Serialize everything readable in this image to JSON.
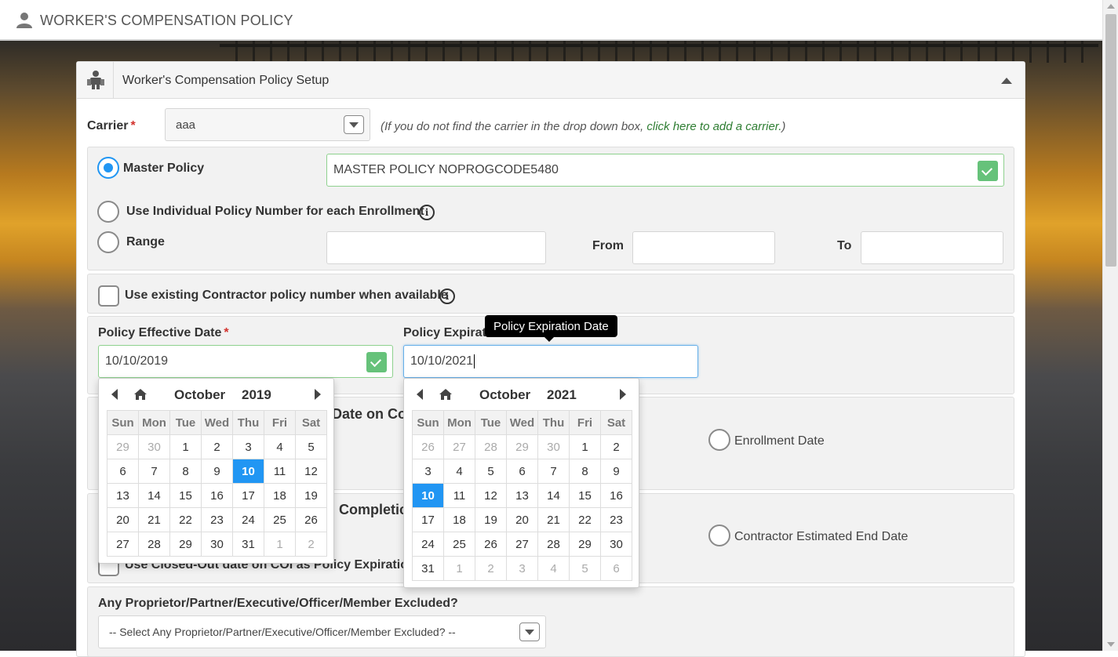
{
  "header": {
    "title": "WORKER'S COMPENSATION POLICY",
    "icon": "user-icon"
  },
  "panel": {
    "title": "Worker's Compensation Policy Setup",
    "icon": "workers-icon"
  },
  "carrier": {
    "label": "Carrier",
    "required_mark": "*",
    "value": "aaa",
    "hint_prefix": "(If you do not find the carrier in the drop down box, ",
    "hint_link": "click here to add a carrier.",
    "hint_suffix": ")"
  },
  "policy_options": {
    "master_label": "Master Policy",
    "master_value": "MASTER POLICY NOPROGCODE5480",
    "individual_label": "Use Individual Policy Number for each Enrollment",
    "range_label": "Range",
    "from_label": "From",
    "to_label": "To"
  },
  "existing_contractor": {
    "label": "Use existing Contractor policy number when available"
  },
  "dates": {
    "effective_label": "Policy Effective Date",
    "effective_value": "10/10/2019",
    "expiration_label_visible": "Policy Expirati",
    "expiration_value": "10/10/2021",
    "tooltip": "Policy Expiration Date"
  },
  "obscured": {
    "heading1_fragment": "Date on Co",
    "heading2_fragment": "Completic",
    "closed_out_label": "Use Closed-Out date on COI as Policy Expiration"
  },
  "radio_options": {
    "enrollment_date": "Enrollment Date",
    "contractor_end": "Contractor Estimated End Date"
  },
  "excluded": {
    "label": "Any Proprietor/Partner/Executive/Officer/Member Excluded?",
    "placeholder": "-- Select Any Proprietor/Partner/Executive/Officer/Member Excluded? --"
  },
  "calendar_effective": {
    "month": "October",
    "year": "2019",
    "weekdays": [
      "Sun",
      "Mon",
      "Tue",
      "Wed",
      "Thu",
      "Fri",
      "Sat"
    ],
    "weeks": [
      [
        [
          "29",
          1
        ],
        [
          "30",
          1
        ],
        [
          "1",
          0
        ],
        [
          "2",
          0
        ],
        [
          "3",
          0
        ],
        [
          "4",
          0
        ],
        [
          "5",
          0
        ]
      ],
      [
        [
          "6",
          0
        ],
        [
          "7",
          0
        ],
        [
          "8",
          0
        ],
        [
          "9",
          0
        ],
        [
          "10",
          2
        ],
        [
          "11",
          0
        ],
        [
          "12",
          0
        ]
      ],
      [
        [
          "13",
          0
        ],
        [
          "14",
          0
        ],
        [
          "15",
          0
        ],
        [
          "16",
          0
        ],
        [
          "17",
          0
        ],
        [
          "18",
          0
        ],
        [
          "19",
          0
        ]
      ],
      [
        [
          "20",
          0
        ],
        [
          "21",
          0
        ],
        [
          "22",
          0
        ],
        [
          "23",
          0
        ],
        [
          "24",
          0
        ],
        [
          "25",
          0
        ],
        [
          "26",
          0
        ]
      ],
      [
        [
          "27",
          0
        ],
        [
          "28",
          0
        ],
        [
          "29",
          0
        ],
        [
          "30",
          0
        ],
        [
          "31",
          0
        ],
        [
          "1",
          1
        ],
        [
          "2",
          1
        ]
      ]
    ]
  },
  "calendar_expiration": {
    "month": "October",
    "year": "2021",
    "weekdays": [
      "Sun",
      "Mon",
      "Tue",
      "Wed",
      "Thu",
      "Fri",
      "Sat"
    ],
    "weeks": [
      [
        [
          "26",
          1
        ],
        [
          "27",
          1
        ],
        [
          "28",
          1
        ],
        [
          "29",
          1
        ],
        [
          "30",
          1
        ],
        [
          "1",
          0
        ],
        [
          "2",
          0
        ]
      ],
      [
        [
          "3",
          0
        ],
        [
          "4",
          0
        ],
        [
          "5",
          0
        ],
        [
          "6",
          0
        ],
        [
          "7",
          0
        ],
        [
          "8",
          0
        ],
        [
          "9",
          0
        ]
      ],
      [
        [
          "10",
          2
        ],
        [
          "11",
          0
        ],
        [
          "12",
          0
        ],
        [
          "13",
          0
        ],
        [
          "14",
          0
        ],
        [
          "15",
          0
        ],
        [
          "16",
          0
        ]
      ],
      [
        [
          "17",
          0
        ],
        [
          "18",
          0
        ],
        [
          "19",
          0
        ],
        [
          "20",
          0
        ],
        [
          "21",
          0
        ],
        [
          "22",
          0
        ],
        [
          "23",
          0
        ]
      ],
      [
        [
          "24",
          0
        ],
        [
          "25",
          0
        ],
        [
          "26",
          0
        ],
        [
          "27",
          0
        ],
        [
          "28",
          0
        ],
        [
          "29",
          0
        ],
        [
          "30",
          0
        ]
      ],
      [
        [
          "31",
          0
        ],
        [
          "1",
          1
        ],
        [
          "2",
          1
        ],
        [
          "3",
          1
        ],
        [
          "4",
          1
        ],
        [
          "5",
          1
        ],
        [
          "6",
          1
        ]
      ]
    ]
  },
  "colors": {
    "accent": "#2196f3",
    "link": "#2e7d32",
    "required": "#d2322d",
    "valid": "#66c27a"
  }
}
